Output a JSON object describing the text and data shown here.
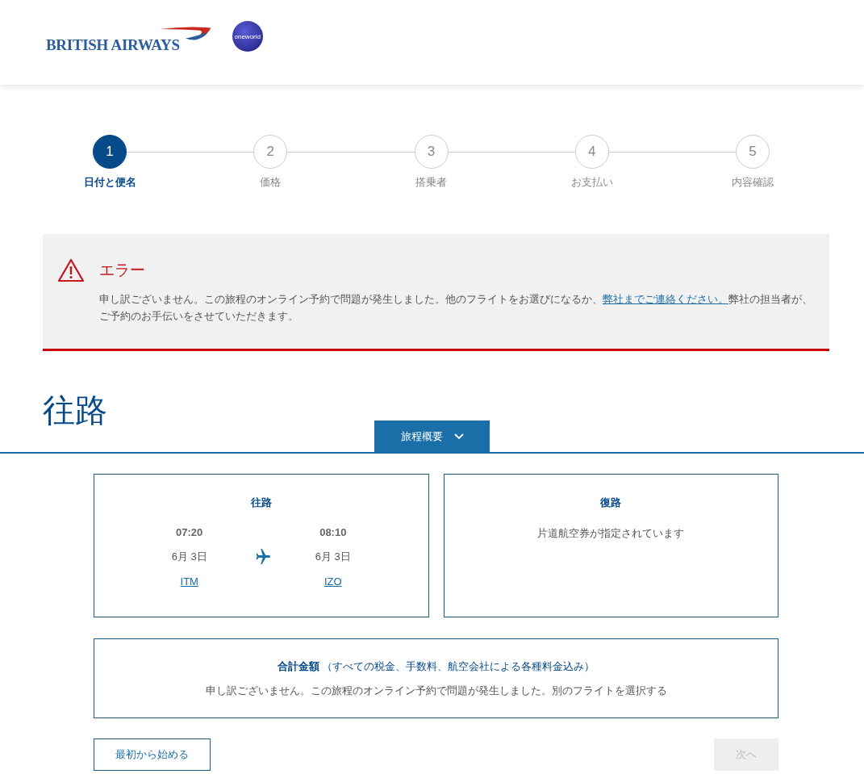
{
  "header": {
    "logo_text": "BRITISH AIRWAYS",
    "badge_text": "oneworld"
  },
  "steps": [
    {
      "number": "1",
      "label": "日付と便名",
      "selected": true
    },
    {
      "number": "2",
      "label": "価格",
      "selected": false
    },
    {
      "number": "3",
      "label": "搭乗者",
      "selected": false
    },
    {
      "number": "4",
      "label": "お支払い",
      "selected": false
    },
    {
      "number": "5",
      "label": "内容確認",
      "selected": false
    }
  ],
  "error": {
    "title": "エラー",
    "text_before": "申し訳ございません。この旅程のオンライン予約で問題が発生しました。他のフライトをお選びになるか、",
    "link": "弊社までご連絡ください。",
    "text_after": "弊社の担当者が、ご予約のお手伝いをさせていただきます。"
  },
  "heading": "往路",
  "summary_toggle": {
    "label": "旅程概要",
    "expanded": true
  },
  "outbound": {
    "title": "往路",
    "depart_time": "07:20",
    "depart_date": "6月 3日",
    "depart_airport": "ITM",
    "arrive_time": "08:10",
    "arrive_date": "6月 3日",
    "arrive_airport": "IZO"
  },
  "inbound": {
    "title": "復路",
    "message": "片道航空券が指定されています"
  },
  "total": {
    "label": "**合計金額** （すべての税金、手数料、航空会社による各種料金込み）",
    "message": "申し訳ございません。この旅程のオンライン予約で問題が発生しました。別のフライトを選択する"
  },
  "buttons": [
    {
      "label": "最初から始める",
      "kind": "secondary",
      "disabled": false
    },
    {
      "label": "次へ",
      "kind": "primary",
      "disabled": true
    }
  ]
}
